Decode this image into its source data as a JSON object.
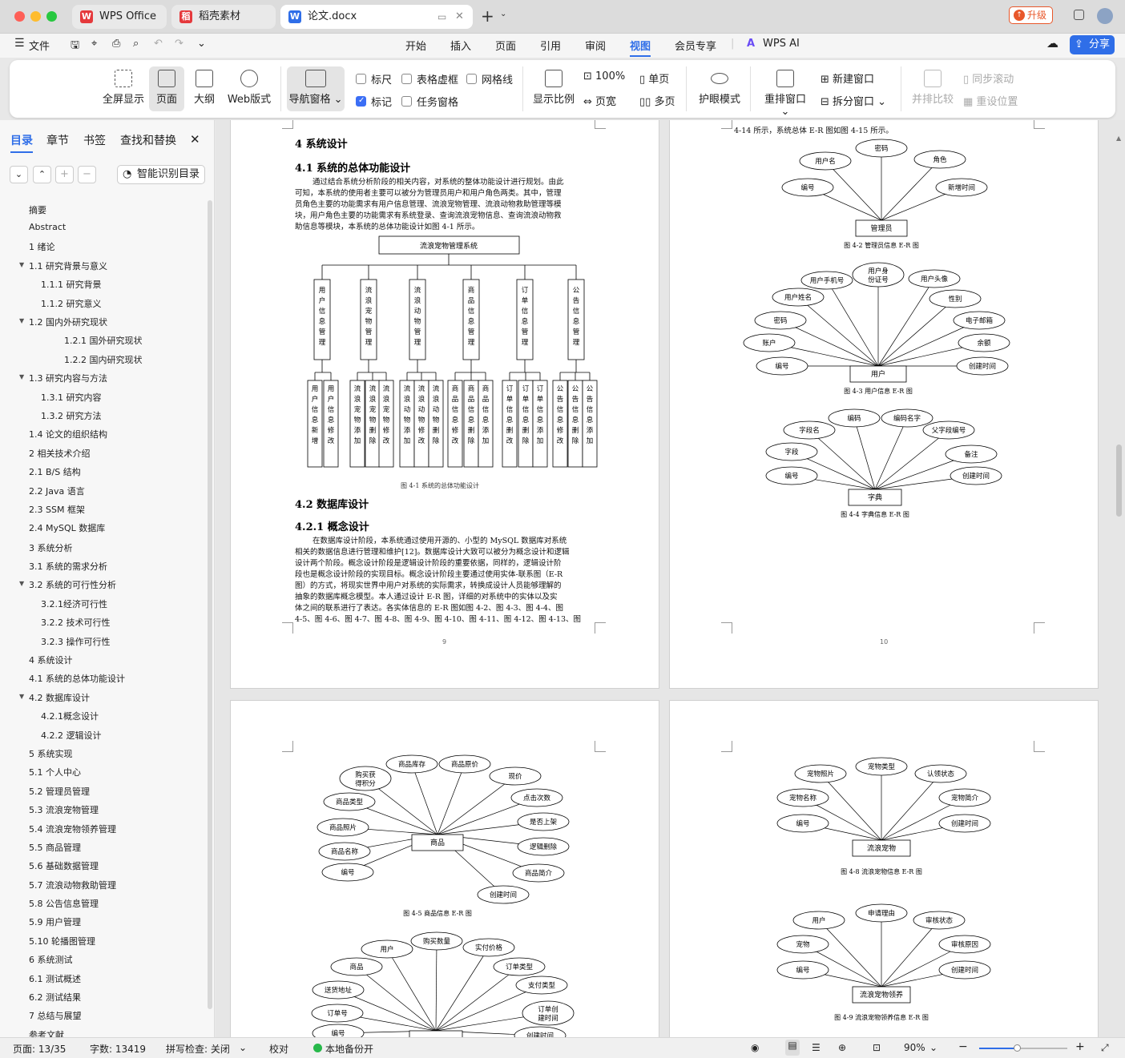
{
  "tabs": [
    {
      "label": "WPS Office"
    },
    {
      "label": "稻壳素材"
    },
    {
      "label": "论文.docx"
    }
  ],
  "titlebar": {
    "upgrade": "升级"
  },
  "menubar": {
    "file": "文件",
    "items": [
      "开始",
      "插入",
      "页面",
      "引用",
      "审阅",
      "视图",
      "会员专享"
    ],
    "wps_ai": "WPS AI",
    "share": "分享"
  },
  "ribbon": {
    "fullscreen": "全屏显示",
    "page": "页面",
    "outline": "大纲",
    "web": "Web版式",
    "nav_pane": "导航窗格",
    "ruler": "标尺",
    "table_grid": "表格虚框",
    "gridline": "网格线",
    "mark": "标记",
    "task_pane": "任务窗格",
    "zoom": "显示比例",
    "zoom100": "100%",
    "single": "单页",
    "page_width": "页宽",
    "multi": "多页",
    "eye": "护眼模式",
    "rearrange": "重排窗口",
    "new_window": "新建窗口",
    "split": "拆分窗口",
    "compare": "并排比较",
    "sync": "同步滚动",
    "reset": "重设位置"
  },
  "sidebar": {
    "tabs": [
      "目录",
      "章节",
      "书签",
      "查找和替换"
    ],
    "smart": "智能识别目录",
    "items": [
      "摘要",
      "Abstract",
      "1 绪论",
      "1.1 研究背景与意义",
      "1.1.1 研究背景",
      "1.1.2 研究意义",
      "1.2 国内外研究现状",
      "1.2.1 国外研究现状",
      "1.2.2 国内研究现状",
      "1.3 研究内容与方法",
      "1.3.1 研究内容",
      "1.3.2 研究方法",
      "1.4 论文的组织结构",
      "2 相关技术介绍",
      "2.1 B/S 结构",
      "2.2 Java 语言",
      "2.3 SSM 框架",
      "2.4 MySQL 数据库",
      "3 系统分析",
      "3.1 系统的需求分析",
      "3.2 系统的可行性分析",
      "3.2.1经济可行性",
      "3.2.2 技术可行性",
      "3.2.3 操作可行性",
      "4 系统设计",
      "4.1 系统的总体功能设计",
      "4.2 数据库设计",
      "4.2.1概念设计",
      "4.2.2 逻辑设计",
      "5 系统实现",
      "5.1 个人中心",
      "5.2 管理员管理",
      "5.3 流浪宠物管理",
      "5.4 流浪宠物领养管理",
      "5.5 商品管理",
      "5.6 基础数据管理",
      "5.7 流浪动物救助管理",
      "5.8 公告信息管理",
      "5.9 用户管理",
      "5.10 轮播图管理",
      "6 系统测试",
      "6.1 测试概述",
      "6.2 测试结果",
      "7 总结与展望",
      "参考文献"
    ]
  },
  "page9": {
    "h1": "4 系统设计",
    "h2": "4.1 系统的总体功能设计",
    "p1": [
      "通过结合系统分析阶段的相关内容，对系统的整体功能设计进行规划。由此",
      "可知，本系统的使用者主要可以被分为管理员用户和用户角色两类。其中，管理",
      "员角色主要的功能需求有用户信息管理、流浪宠物管理、流浪动物救助管理等模",
      "块，用户角色主要的功能需求有系统登录、查询流浪宠物信息、查询流浪动物救",
      "助信息等模块，本系统的总体功能设计如图 4-1 所示。"
    ],
    "tree_root": "流浪宠物管理系统",
    "tree_mods": [
      "用户信息管理",
      "流浪宠物管理",
      "流浪动物管理",
      "商品信息管理",
      "订单信息管理",
      "公告信息管理"
    ],
    "tree_leaves": [
      "用户信息新增",
      "用户信息修改",
      "流浪宠物添加",
      "流浪宠物删除",
      "流浪宠物修改",
      "流浪动物添加",
      "流浪动物修改",
      "流浪动物删除",
      "商品信息修改",
      "商品信息删除",
      "商品信息添加",
      "订单信息删改",
      "订单信息删除",
      "订单信息添加",
      "公告信息修改",
      "公告信息删除",
      "公告信息添加"
    ],
    "cap1": "图 4-1 系统的总体功能设计",
    "h3": "4.2 数据库设计",
    "h4": "4.2.1 概念设计",
    "p2": [
      "在数据库设计阶段，本系统通过使用开源的、小型的 MySQL 数据库对系统",
      "相关的数据信息进行管理和维护[12]。数据库设计大致可以被分为概念设计和逻辑",
      "设计两个阶段。概念设计阶段是逻辑设计阶段的重要依据，同样的，逻辑设计阶",
      "段也是概念设计阶段的实现目标。概念设计阶段主要通过使用实体-联系图（E-R",
      "图）的方式，将现实世界中用户对系统的实际需求，转换成设计人员能够理解的",
      "抽象的数据库概念模型。本人通过设计 E-R 图，详细的对系统中的实体以及实",
      "体之间的联系进行了表达。各实体信息的 E-R 图如图 4-2、图 4-3、图 4-4、图",
      "4-5、图 4-6、图 4-7、图 4-8、图 4-9、图 4-10、图 4-11、图 4-12、图 4-13、图"
    ],
    "num": "9"
  },
  "page10": {
    "top": "4-14 所示，系统总体 E-R 图如图 4-15 所示。",
    "num": "10",
    "er": [
      {
        "entity": "管理员",
        "attrs": [
          "用户名",
          "密码",
          "角色",
          "编号",
          "新增时间"
        ],
        "cap": "图 4-2 管理员信息 E-R 图"
      },
      {
        "entity": "用户",
        "attrs": [
          "用户手机号",
          "用户身份证号",
          "用户头像",
          "用户姓名",
          "性别",
          "密码",
          "电子邮箱",
          "账户",
          "余额",
          "编号",
          "创建时间"
        ],
        "cap": "图 4-3 用户信息 E-R 图"
      },
      {
        "entity": "字典",
        "attrs": [
          "编码",
          "编码名字",
          "字段名",
          "父字段编号",
          "字段",
          "备注",
          "编号",
          "创建时间"
        ],
        "cap": "图 4-4 字典信息 E-R 图"
      }
    ]
  },
  "page11": {
    "er": [
      {
        "entity": "商品",
        "attrs": [
          "商品库存",
          "商品原价",
          "购买获得积分",
          "现价",
          "商品类型",
          "点击次数",
          "是否上架",
          "商品照片",
          "逻辑删除",
          "商品名称",
          "商品简介",
          "编号",
          "创建时间"
        ],
        "cap": "图 4-5 商品信息 E-R 图"
      },
      {
        "entity": "",
        "attrs": [
          "购买数量",
          "用户",
          "实付价格",
          "商品",
          "订单类型",
          "支付类型",
          "送货地址",
          "订单创建时间",
          "订单号",
          "编号",
          "创建时间"
        ]
      }
    ]
  },
  "page12": {
    "er": [
      {
        "entity": "流浪宠物",
        "attrs": [
          "宠物照片",
          "宠物类型",
          "认领状态",
          "宠物名称",
          "宠物简介",
          "编号",
          "创建时间"
        ],
        "cap": "图 4-8 流浪宠物信息 E-R 图"
      },
      {
        "entity": "流浪宠物领养",
        "attrs": [
          "用户",
          "申请理由",
          "审核状态",
          "宠物",
          "审核原因",
          "编号",
          "创建时间"
        ],
        "cap": "图 4-9 流浪宠物领养信息 E-R 图"
      }
    ]
  },
  "status": {
    "page": "页面: 13/35",
    "words": "字数: 13419",
    "spell": "拼写检查: 关闭",
    "proof": "校对",
    "backup": "本地备份开",
    "zoom": "90%"
  },
  "colors": {
    "accent": "#3b6ef5",
    "wps_red": "#e5393c",
    "upgrade": "#e8572a"
  }
}
